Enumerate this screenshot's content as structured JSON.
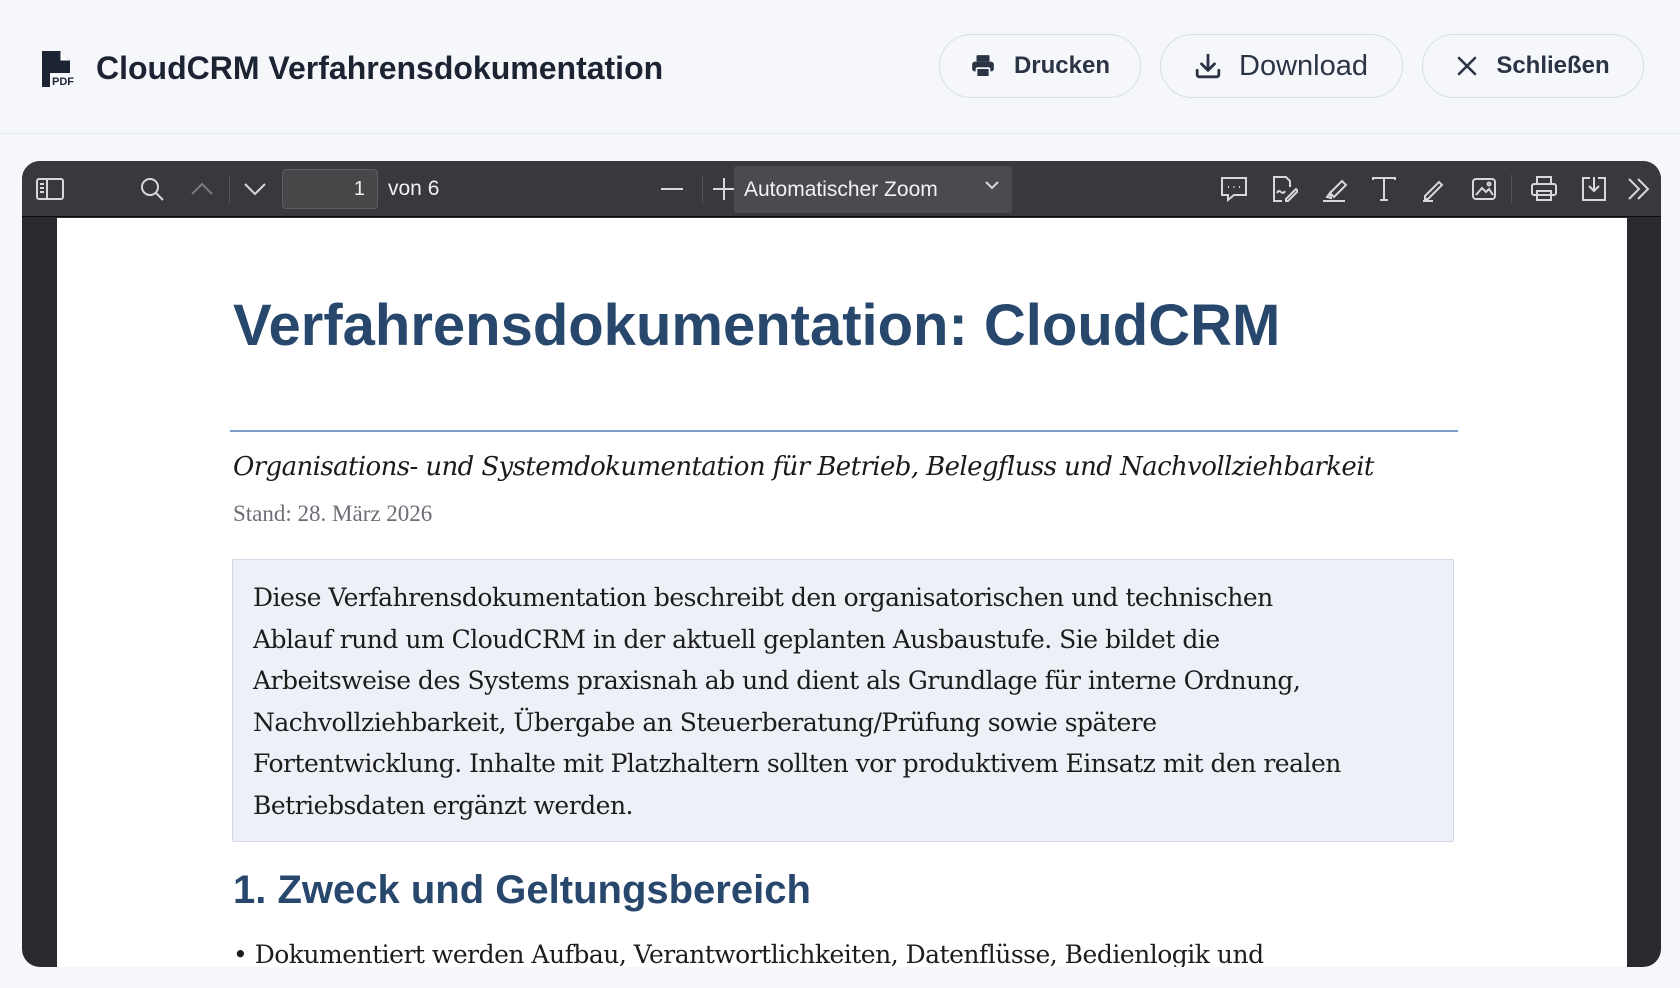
{
  "header": {
    "title": "CloudCRM Verfahrensdokumentation",
    "icon": "pdf-file-icon",
    "buttons": {
      "print": "Drucken",
      "download": "Download",
      "close": "Schließen"
    }
  },
  "toolbar": {
    "page_current": "1",
    "page_total": "von 6",
    "zoom": "Automatischer Zoom"
  },
  "document": {
    "title": "Verfahrensdokumentation: CloudCRM",
    "subtitle": "Organisations- und Systemdokumentation für Betrieb, Belegfluss und Nachvollziehbarkeit",
    "date": "Stand: 28. März 2026",
    "intro_lines": [
      "Diese Verfahrensdokumentation beschreibt den organisatorischen und technischen",
      "Ablauf rund um CloudCRM in der aktuell geplanten Ausbaustufe. Sie bildet die",
      "Arbeitsweise des Systems praxisnah ab und dient als Grundlage für interne Ordnung,",
      "Nachvollziehbarkeit, Übergabe an Steuerberatung/Prüfung sowie spätere",
      "Fortentwicklung. Inhalte mit Platzhaltern sollten vor produktivem Einsatz mit den realen",
      "Betriebsdaten ergänzt werden."
    ],
    "section1_heading": "1. Zweck und Geltungsbereich",
    "section1_bullet": "• Dokumentiert werden Aufbau, Verantwortlichkeiten, Datenflüsse, Bedienlogik und"
  }
}
